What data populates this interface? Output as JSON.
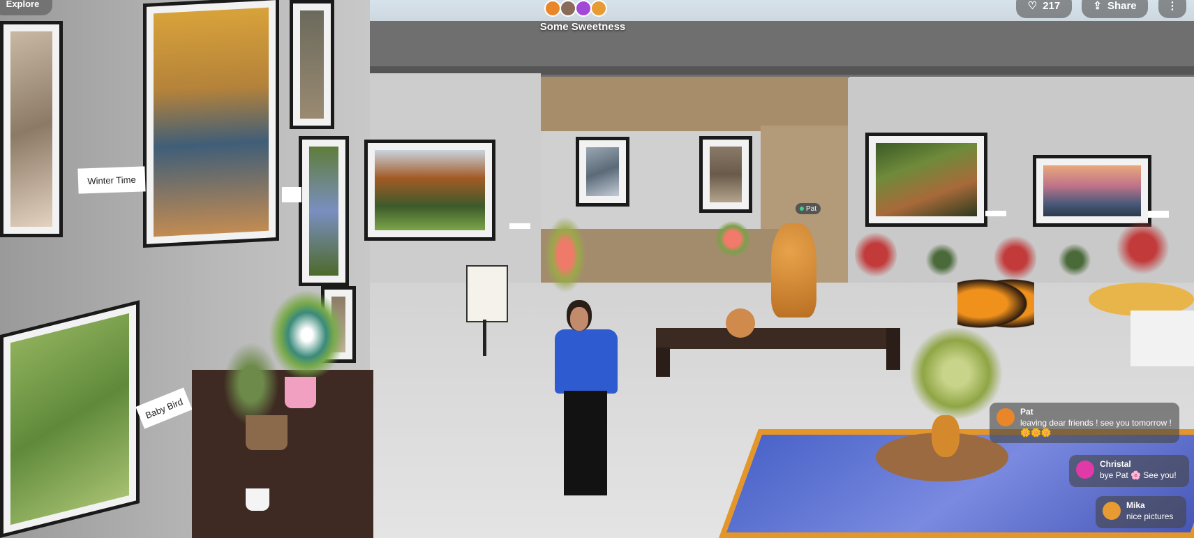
{
  "hud": {
    "explore_label": "Explore",
    "room_title": "Some Sweetness",
    "likes_count": "217",
    "share_label": "Share",
    "more_label": "⋮"
  },
  "room_avatars": [
    "#e9862a",
    "#8a6b5a",
    "#a349d8",
    "#e79b32"
  ],
  "artwork_labels": {
    "winter_time": "Winter Time",
    "baby_bird": "Baby Bird"
  },
  "nametag": {
    "pat": "Pat"
  },
  "chat": [
    {
      "name": "Pat",
      "message": "leaving dear friends ! see you tomorrow !",
      "emoji": "🌼🌼🌼",
      "avatar_color": "#e9862a"
    },
    {
      "name": "Christal",
      "message": "bye Pat 🌸 See you!",
      "avatar_color": "#e13aa8"
    },
    {
      "name": "Mika",
      "message": "nice pictures",
      "avatar_color": "#e79b32"
    }
  ],
  "colors": {
    "hud_bg": "rgba(90,90,90,0.65)",
    "chat_bg": "rgba(70,70,70,0.62)",
    "accent_online": "#3dd18a"
  }
}
